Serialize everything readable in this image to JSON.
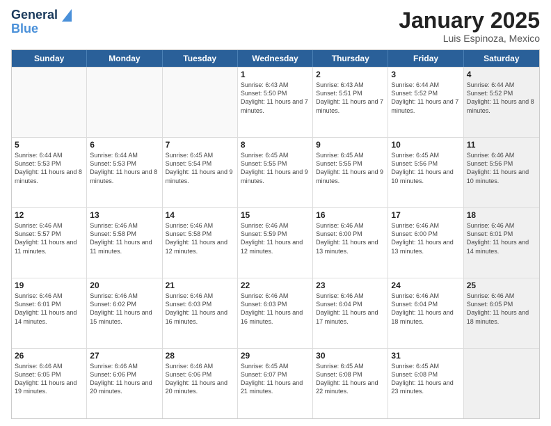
{
  "header": {
    "logo_line1": "General",
    "logo_line2": "Blue",
    "title": "January 2025",
    "subtitle": "Luis Espinoza, Mexico"
  },
  "calendar": {
    "days_of_week": [
      "Sunday",
      "Monday",
      "Tuesday",
      "Wednesday",
      "Thursday",
      "Friday",
      "Saturday"
    ],
    "weeks": [
      [
        {
          "day": "",
          "empty": true
        },
        {
          "day": "",
          "empty": true
        },
        {
          "day": "",
          "empty": true
        },
        {
          "day": "1",
          "sunrise": "6:43 AM",
          "sunset": "5:50 PM",
          "daylight": "11 hours and 7 minutes."
        },
        {
          "day": "2",
          "sunrise": "6:43 AM",
          "sunset": "5:51 PM",
          "daylight": "11 hours and 7 minutes."
        },
        {
          "day": "3",
          "sunrise": "6:44 AM",
          "sunset": "5:52 PM",
          "daylight": "11 hours and 7 minutes."
        },
        {
          "day": "4",
          "sunrise": "6:44 AM",
          "sunset": "5:52 PM",
          "daylight": "11 hours and 8 minutes.",
          "shaded": true
        }
      ],
      [
        {
          "day": "5",
          "sunrise": "6:44 AM",
          "sunset": "5:53 PM",
          "daylight": "11 hours and 8 minutes."
        },
        {
          "day": "6",
          "sunrise": "6:44 AM",
          "sunset": "5:53 PM",
          "daylight": "11 hours and 8 minutes."
        },
        {
          "day": "7",
          "sunrise": "6:45 AM",
          "sunset": "5:54 PM",
          "daylight": "11 hours and 9 minutes."
        },
        {
          "day": "8",
          "sunrise": "6:45 AM",
          "sunset": "5:55 PM",
          "daylight": "11 hours and 9 minutes."
        },
        {
          "day": "9",
          "sunrise": "6:45 AM",
          "sunset": "5:55 PM",
          "daylight": "11 hours and 9 minutes."
        },
        {
          "day": "10",
          "sunrise": "6:45 AM",
          "sunset": "5:56 PM",
          "daylight": "11 hours and 10 minutes."
        },
        {
          "day": "11",
          "sunrise": "6:46 AM",
          "sunset": "5:56 PM",
          "daylight": "11 hours and 10 minutes.",
          "shaded": true
        }
      ],
      [
        {
          "day": "12",
          "sunrise": "6:46 AM",
          "sunset": "5:57 PM",
          "daylight": "11 hours and 11 minutes."
        },
        {
          "day": "13",
          "sunrise": "6:46 AM",
          "sunset": "5:58 PM",
          "daylight": "11 hours and 11 minutes."
        },
        {
          "day": "14",
          "sunrise": "6:46 AM",
          "sunset": "5:58 PM",
          "daylight": "11 hours and 12 minutes."
        },
        {
          "day": "15",
          "sunrise": "6:46 AM",
          "sunset": "5:59 PM",
          "daylight": "11 hours and 12 minutes."
        },
        {
          "day": "16",
          "sunrise": "6:46 AM",
          "sunset": "6:00 PM",
          "daylight": "11 hours and 13 minutes."
        },
        {
          "day": "17",
          "sunrise": "6:46 AM",
          "sunset": "6:00 PM",
          "daylight": "11 hours and 13 minutes."
        },
        {
          "day": "18",
          "sunrise": "6:46 AM",
          "sunset": "6:01 PM",
          "daylight": "11 hours and 14 minutes.",
          "shaded": true
        }
      ],
      [
        {
          "day": "19",
          "sunrise": "6:46 AM",
          "sunset": "6:01 PM",
          "daylight": "11 hours and 14 minutes."
        },
        {
          "day": "20",
          "sunrise": "6:46 AM",
          "sunset": "6:02 PM",
          "daylight": "11 hours and 15 minutes."
        },
        {
          "day": "21",
          "sunrise": "6:46 AM",
          "sunset": "6:03 PM",
          "daylight": "11 hours and 16 minutes."
        },
        {
          "day": "22",
          "sunrise": "6:46 AM",
          "sunset": "6:03 PM",
          "daylight": "11 hours and 16 minutes."
        },
        {
          "day": "23",
          "sunrise": "6:46 AM",
          "sunset": "6:04 PM",
          "daylight": "11 hours and 17 minutes."
        },
        {
          "day": "24",
          "sunrise": "6:46 AM",
          "sunset": "6:04 PM",
          "daylight": "11 hours and 18 minutes."
        },
        {
          "day": "25",
          "sunrise": "6:46 AM",
          "sunset": "6:05 PM",
          "daylight": "11 hours and 18 minutes.",
          "shaded": true
        }
      ],
      [
        {
          "day": "26",
          "sunrise": "6:46 AM",
          "sunset": "6:05 PM",
          "daylight": "11 hours and 19 minutes."
        },
        {
          "day": "27",
          "sunrise": "6:46 AM",
          "sunset": "6:06 PM",
          "daylight": "11 hours and 20 minutes."
        },
        {
          "day": "28",
          "sunrise": "6:46 AM",
          "sunset": "6:06 PM",
          "daylight": "11 hours and 20 minutes."
        },
        {
          "day": "29",
          "sunrise": "6:45 AM",
          "sunset": "6:07 PM",
          "daylight": "11 hours and 21 minutes."
        },
        {
          "day": "30",
          "sunrise": "6:45 AM",
          "sunset": "6:08 PM",
          "daylight": "11 hours and 22 minutes."
        },
        {
          "day": "31",
          "sunrise": "6:45 AM",
          "sunset": "6:08 PM",
          "daylight": "11 hours and 23 minutes."
        },
        {
          "day": "",
          "empty": true,
          "shaded": true
        }
      ]
    ]
  }
}
